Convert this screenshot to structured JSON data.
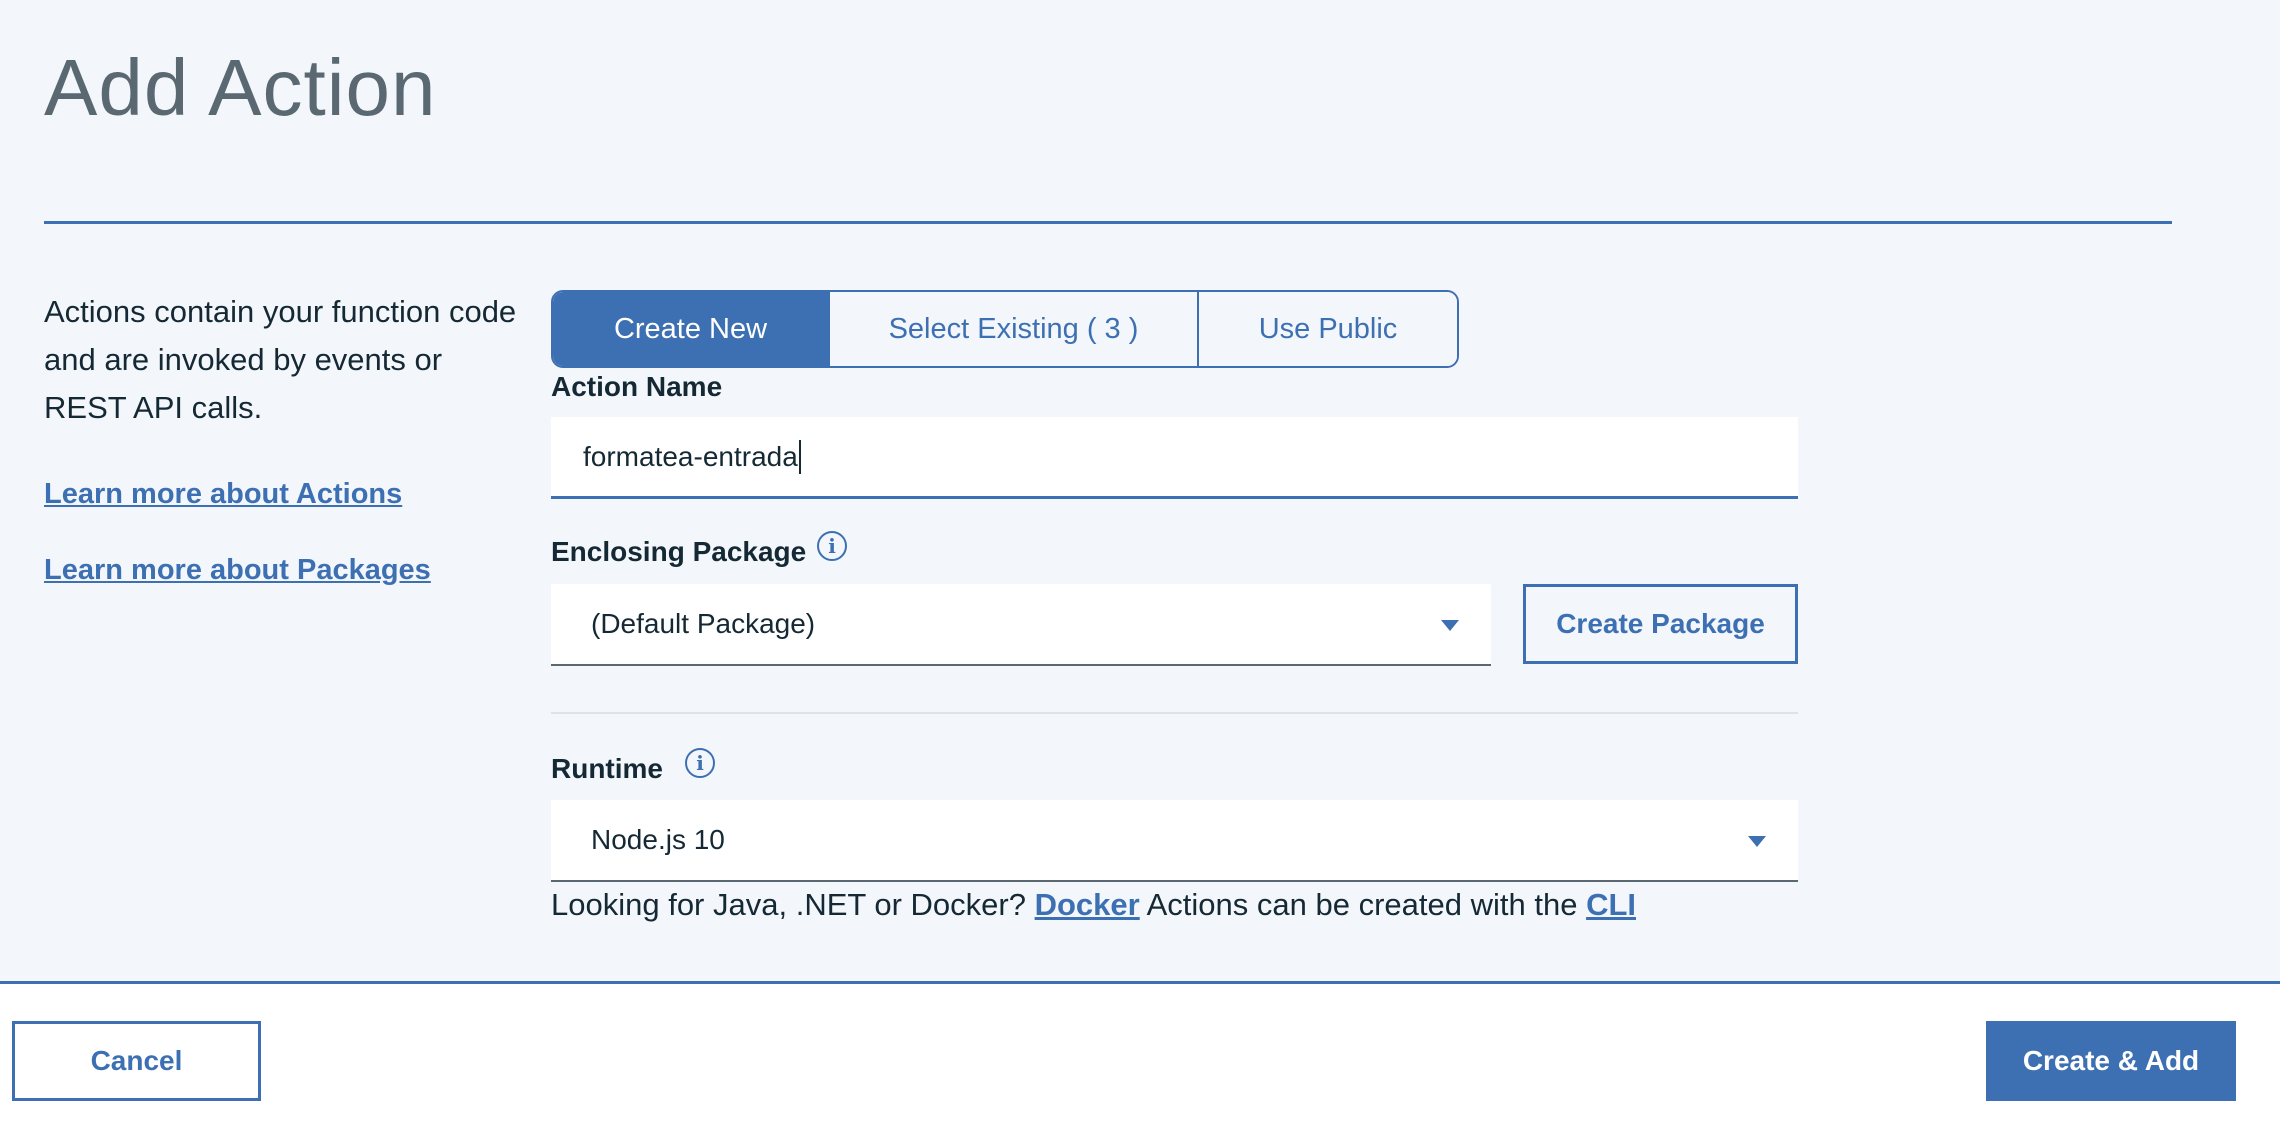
{
  "page": {
    "title": "Add Action"
  },
  "sidebar": {
    "description": "Actions contain your function code and are invoked by events or REST API calls.",
    "links": [
      {
        "label": "Learn more about Actions"
      },
      {
        "label": "Learn more about Packages"
      }
    ]
  },
  "tabs": [
    {
      "label": "Create New",
      "active": true
    },
    {
      "label": "Select Existing ( 3 )",
      "active": false
    },
    {
      "label": "Use Public",
      "active": false
    }
  ],
  "form": {
    "action_name": {
      "label": "Action Name",
      "value": "formatea-entrada"
    },
    "enclosing_package": {
      "label": "Enclosing Package",
      "value": "(Default Package)",
      "create_button": "Create Package"
    },
    "runtime": {
      "label": "Runtime",
      "value": "Node.js 10"
    },
    "hint": {
      "prefix": "Looking for Java, .NET or Docker?",
      "docker_link": "Docker",
      "middle": "Actions can be created with the",
      "cli_link": "CLI"
    }
  },
  "footer": {
    "cancel_label": "Cancel",
    "submit_label": "Create & Add"
  },
  "colors": {
    "accent": "#3d70b2",
    "background": "#f3f6fb",
    "text": "#152935",
    "title": "#5a6872"
  },
  "icons": {
    "info": "info-circle-icon",
    "dropdown": "chevron-down-icon"
  }
}
